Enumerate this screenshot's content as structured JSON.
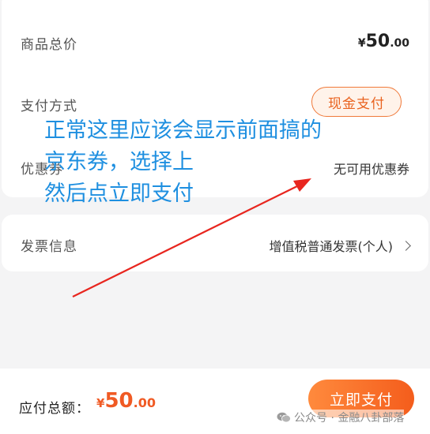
{
  "summary": {
    "goods_total_label": "商品总价",
    "goods_total_currency": "¥",
    "goods_total_int": "50",
    "goods_total_dec": ".00",
    "pay_method_label": "支付方式",
    "pay_method_value": "现金支付",
    "coupon_label": "优惠券",
    "coupon_value": "无可用优惠券"
  },
  "invoice": {
    "label": "发票信息",
    "value": "增值税普通发票(个人)"
  },
  "footer": {
    "total_label": "应付总额：",
    "total_currency": "¥",
    "total_int": "50",
    "total_dec": ".00",
    "pay_button": "立即支付"
  },
  "watermark": {
    "text": "公众号 · 金融八卦部落",
    "icon": "wechat-icon"
  },
  "annotation": {
    "lines": [
      "正常这里应该会显示前面搞的",
      "京东券，选择上",
      "然后点立即支付"
    ]
  },
  "colors": {
    "accent": "#f45d1c",
    "annotation": "#1e8fe0",
    "arrow": "#e8261f"
  }
}
